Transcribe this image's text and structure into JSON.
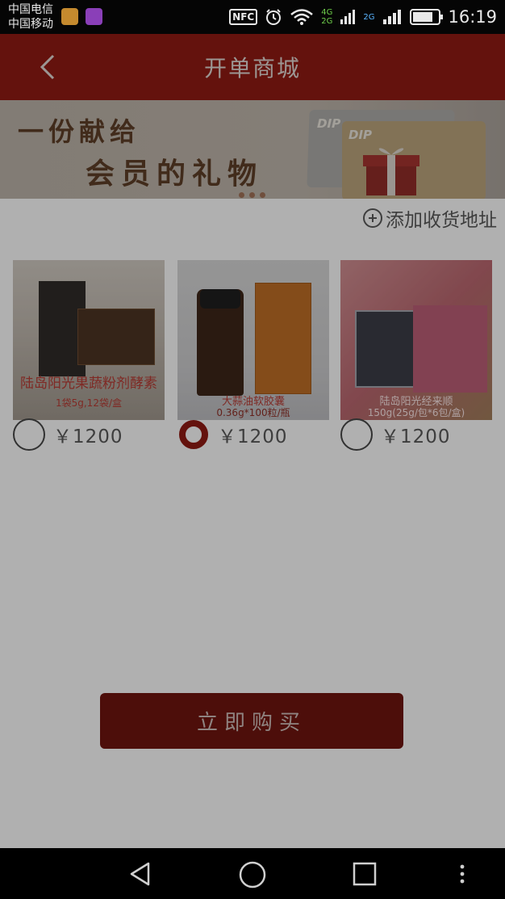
{
  "status_bar": {
    "carrier_1": "中国电信",
    "carrier_2": "中国移动",
    "net_top": "4G",
    "net_bottom": "2G",
    "net_2": "2G",
    "nfc": "NFC",
    "time": "16:19",
    "icons": [
      "notification-app-icon",
      "gallery-icon",
      "nfc-icon",
      "alarm-icon",
      "wifi-icon",
      "signal-icon",
      "signal-icon",
      "battery-icon"
    ]
  },
  "header": {
    "title": "开单商城",
    "back_icon": "chevron-left-icon"
  },
  "banner": {
    "line1": "一份献给",
    "line2": "会员的礼物",
    "card_label": "DIP"
  },
  "address": {
    "label": "添加收货地址",
    "icon": "plus-circle-icon"
  },
  "products": [
    {
      "name": "陆岛阳光果蔬粉剂酵素",
      "spec": "1袋5g,12袋/盒",
      "price": "￥1200",
      "selected": false
    },
    {
      "name": "大蒜油软胶囊",
      "spec": "0.36g*100粒/瓶",
      "price": "￥1200",
      "selected": true
    },
    {
      "name": "陆岛阳光经来顺",
      "spec": "150g(25g/包*6包/盒)",
      "price": "￥1200",
      "selected": false
    }
  ],
  "buy_button": {
    "label": "立即购买"
  },
  "colors": {
    "brand_red": "#8b1a12",
    "status_bar": "#050505",
    "nav_bar": "#000000"
  },
  "nav_bar": {
    "icons": [
      "back-triangle-icon",
      "home-circle-icon",
      "recents-square-icon",
      "menu-dots-icon"
    ]
  }
}
